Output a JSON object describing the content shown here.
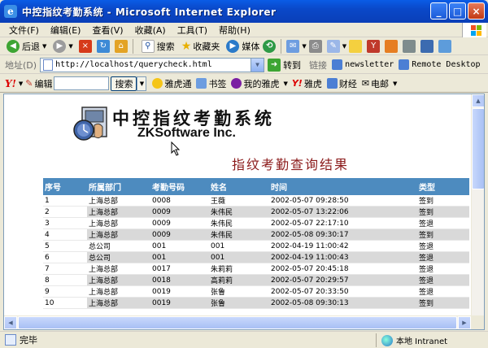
{
  "window": {
    "title": "中控指纹考勤系统 - Microsoft Internet Explorer",
    "minimize": "_",
    "maximize": "□",
    "close": "×"
  },
  "menu": [
    "文件(F)",
    "编辑(E)",
    "查看(V)",
    "收藏(A)",
    "工具(T)",
    "帮助(H)"
  ],
  "toolbar": {
    "back": "后退",
    "search": "搜索",
    "favorites": "收藏夹",
    "media": "媒体"
  },
  "address": {
    "label": "地址(D)",
    "url": "http://localhost/querycheck.html",
    "go": "转到",
    "links_label": "链接",
    "links": [
      "newsletter",
      "Remote Desktop"
    ]
  },
  "yahoo": {
    "logo": "Y!",
    "edit": "编辑",
    "search_button": "搜索",
    "items": [
      "雅虎通",
      "书签",
      "我的雅虎",
      "雅虎",
      "财经",
      "电邮"
    ]
  },
  "page": {
    "logo_title": "中控指纹考勤系统",
    "logo_subtitle": "ZKSoftware Inc.",
    "result_title": "指纹考勤查询结果",
    "columns": [
      "序号",
      "所属部门",
      "考勤号码",
      "姓名",
      "时间",
      "类型"
    ],
    "rows": [
      [
        "1",
        "上海总部",
        "0008",
        "王薇",
        "2002-05-07 09:28:50",
        "签到"
      ],
      [
        "2",
        "上海总部",
        "0009",
        "朱伟民",
        "2002-05-07 13:22:06",
        "签到"
      ],
      [
        "3",
        "上海总部",
        "0009",
        "朱伟民",
        "2002-05-07 22:17:10",
        "签退"
      ],
      [
        "4",
        "上海总部",
        "0009",
        "朱伟民",
        "2002-05-08 09:30:17",
        "签到"
      ],
      [
        "5",
        "总公司",
        "001",
        "001",
        "2002-04-19 11:00:42",
        "签退"
      ],
      [
        "6",
        "总公司",
        "001",
        "001",
        "2002-04-19 11:00:43",
        "签退"
      ],
      [
        "7",
        "上海总部",
        "0017",
        "朱莉莉",
        "2002-05-07 20:45:18",
        "签退"
      ],
      [
        "8",
        "上海总部",
        "0018",
        "高莉莉",
        "2002-05-07 20:29:57",
        "签退"
      ],
      [
        "9",
        "上海总部",
        "0019",
        "张鲁",
        "2002-05-07 20:33:50",
        "签退"
      ],
      [
        "10",
        "上海总部",
        "0019",
        "张鲁",
        "2002-05-08 09:30:13",
        "签到"
      ]
    ]
  },
  "status": {
    "text": "完毕",
    "zone": "本地 Intranet"
  }
}
